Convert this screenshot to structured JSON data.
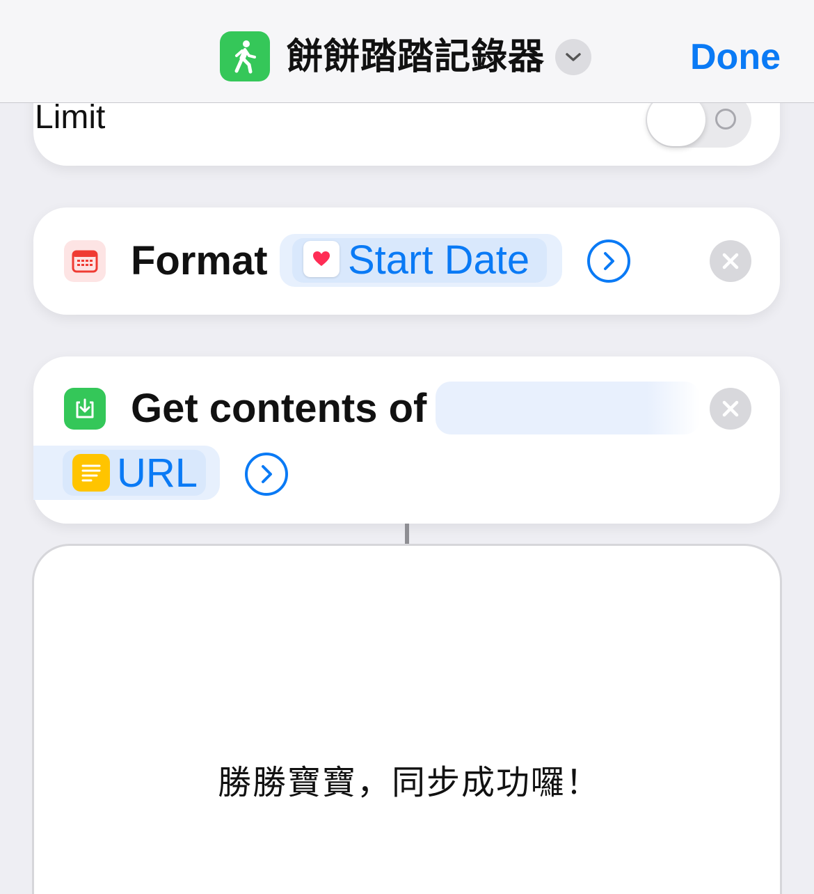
{
  "nav": {
    "title": "餅餅踏踏記錄器",
    "done_label": "Done",
    "app_icon": "walking-person-icon",
    "accent_color": "#0a7af5",
    "app_icon_color": "#35c759"
  },
  "actions": [
    {
      "label": "Limit",
      "control": "toggle",
      "toggle_on": false
    },
    {
      "icon": "calendar-icon",
      "label": "Format",
      "variable": {
        "icon": "heart-icon",
        "text": "Start Date"
      }
    },
    {
      "icon": "download-icon",
      "label": "Get contents of",
      "variable": {
        "icon": "text-document-icon",
        "text": "URL"
      }
    }
  ],
  "result": {
    "text": "勝勝寶寶，同步成功囉！"
  }
}
